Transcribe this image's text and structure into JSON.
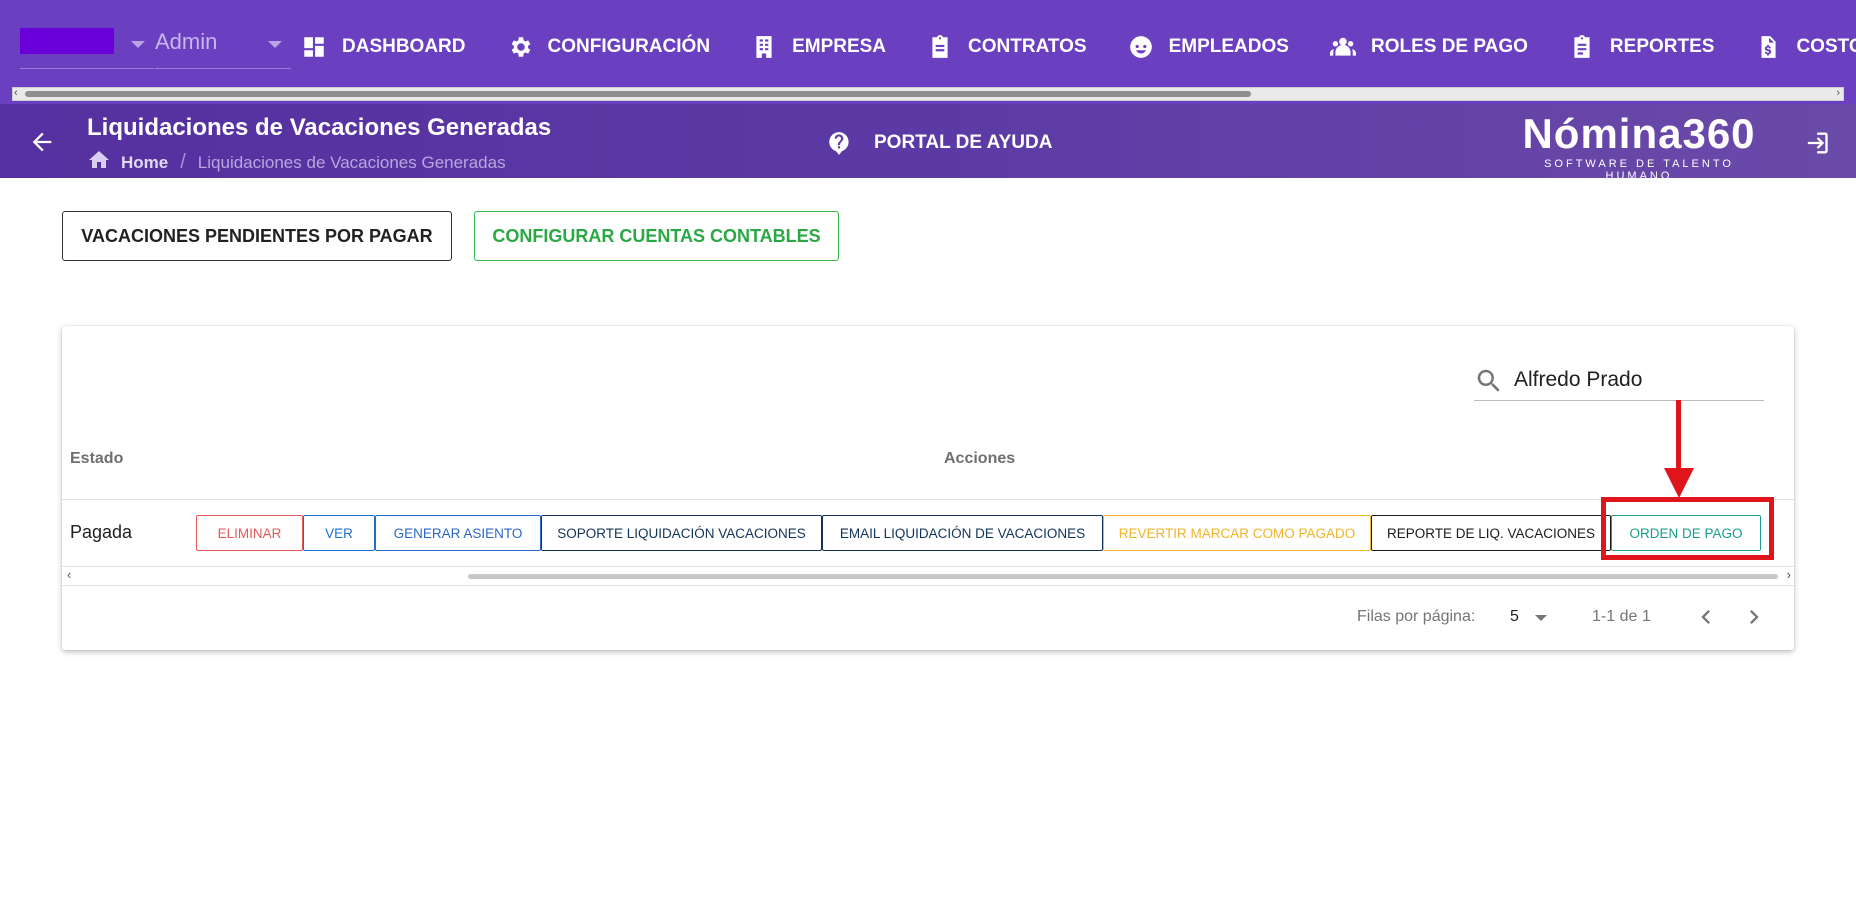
{
  "nav": {
    "role": "Admin",
    "items": [
      {
        "label": "DASHBOARD",
        "icon": "dashboard-icon"
      },
      {
        "label": "CONFIGURACIÓN",
        "icon": "gear-icon"
      },
      {
        "label": "EMPRESA",
        "icon": "building-icon"
      },
      {
        "label": "CONTRATOS",
        "icon": "clipboard-icon"
      },
      {
        "label": "EMPLEADOS",
        "icon": "face-icon"
      },
      {
        "label": "ROLES DE PAGO",
        "icon": "group-icon"
      },
      {
        "label": "REPORTES",
        "icon": "clipboard-list-icon"
      },
      {
        "label": "COSTOS",
        "icon": "file-dollar-icon"
      }
    ]
  },
  "header": {
    "title": "Liquidaciones de Vacaciones Generadas",
    "breadcrumb_home": "Home",
    "breadcrumb_sep": "/",
    "breadcrumb_current": "Liquidaciones de Vacaciones Generadas",
    "help": "PORTAL DE AYUDA",
    "logo": "Nómina360",
    "logo_tagline": "SOFTWARE DE TALENTO HUMANO"
  },
  "buttons": {
    "pending": "VACACIONES PENDIENTES POR PAGAR",
    "accounts": "CONFIGURAR CUENTAS CONTABLES"
  },
  "table": {
    "search_value": "Alfredo Prado",
    "columns": {
      "estado": "Estado",
      "acciones": "Acciones"
    },
    "rows": [
      {
        "estado": "Pagada",
        "actions": [
          {
            "label": "ELIMINAR",
            "color": "#e45a5a"
          },
          {
            "label": "VER",
            "color": "#1e6fcf"
          },
          {
            "label": "GENERAR ASIENTO",
            "color": "#2a67c9"
          },
          {
            "label": "SOPORTE LIQUIDACIÓN VACACIONES",
            "color": "#12345a"
          },
          {
            "label": "EMAIL LIQUIDACIÓN DE VACACIONES",
            "color": "#12345a"
          },
          {
            "label": "REVERTIR MARCAR COMO PAGADO",
            "color": "#f0b429"
          },
          {
            "label": "REPORTE DE LIQ. VACACIONES",
            "color": "#1b1b1b"
          },
          {
            "label": "ORDEN DE PAGO",
            "color": "#1a9f8a"
          }
        ]
      }
    ],
    "rows_per_page_label": "Filas por página:",
    "rows_per_page": "5",
    "range": "1-1 de 1"
  },
  "colors": {
    "nav_bg": "#6a3fc0",
    "header_bg": "#5530a0",
    "annotation": "#e0151c"
  }
}
